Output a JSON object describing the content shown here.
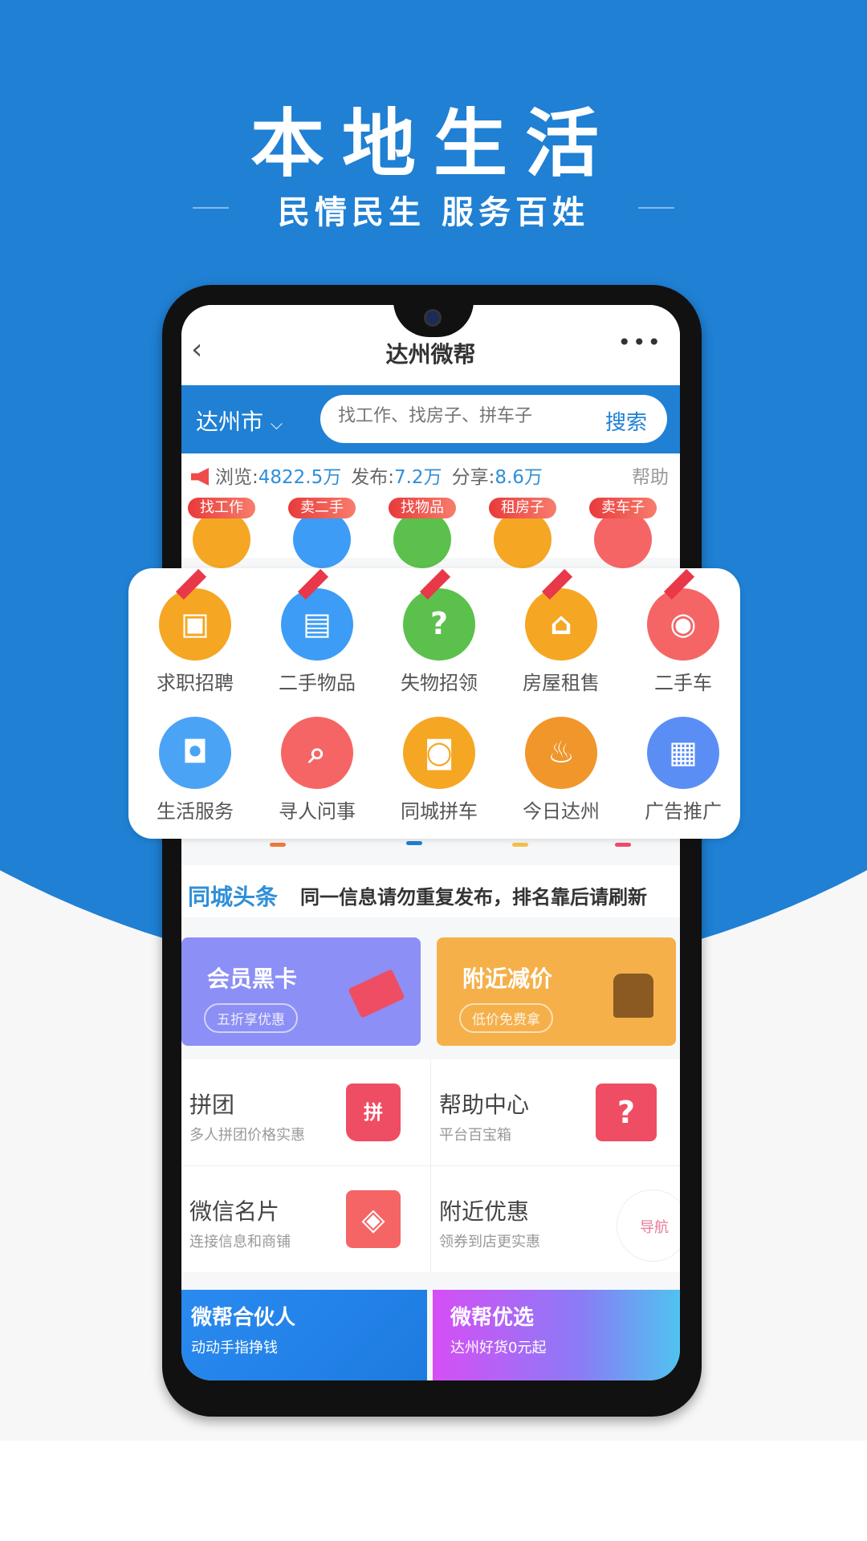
{
  "hero": {
    "title": "本地生活",
    "subtitle": "民情民生 服务百姓"
  },
  "app": {
    "title": "达州微帮",
    "back_icon": "‹",
    "more_icon": "•••",
    "city": "达州市",
    "city_chevron": "⌵",
    "search": {
      "placeholder": "找工作、找房子、拼车子",
      "button": "搜索"
    },
    "stats": {
      "views_label": "浏览:",
      "views": "4822.5万",
      "posts_label": "发布:",
      "posts": "7.2万",
      "shares_label": "分享:",
      "shares": "8.6万",
      "help": "帮助"
    },
    "badges": [
      {
        "tag": "找工作",
        "color": "#f5a623"
      },
      {
        "tag": "卖二手",
        "color": "#3d9cf5"
      },
      {
        "tag": "找物品",
        "color": "#5cc04c"
      },
      {
        "tag": "租房子",
        "color": "#f5a623"
      },
      {
        "tag": "卖车子",
        "color": "#f56565"
      }
    ],
    "categories": [
      {
        "label": "求职招聘",
        "icon": "briefcase-icon",
        "glyph": "▣",
        "color": "#f5a623",
        "ribbon": true
      },
      {
        "label": "二手物品",
        "icon": "bag-icon",
        "glyph": "▤",
        "color": "#3d9cf5",
        "ribbon": true
      },
      {
        "label": "失物招领",
        "icon": "lost-found-icon",
        "glyph": "?",
        "color": "#5cc04c",
        "ribbon": true
      },
      {
        "label": "房屋租售",
        "icon": "house-icon",
        "glyph": "⌂",
        "color": "#f5a623",
        "ribbon": true
      },
      {
        "label": "二手车",
        "icon": "car-icon",
        "glyph": "◉",
        "color": "#f56565",
        "ribbon": true
      },
      {
        "label": "生活服务",
        "icon": "service-icon",
        "glyph": "◘",
        "color": "#4ba3f5",
        "ribbon": false
      },
      {
        "label": "寻人问事",
        "icon": "search-person-icon",
        "glyph": "⌕",
        "color": "#f56565",
        "ribbon": false
      },
      {
        "label": "同城拼车",
        "icon": "taxi-icon",
        "glyph": "◙",
        "color": "#f5a623",
        "ribbon": false
      },
      {
        "label": "今日达州",
        "icon": "fire-icon",
        "glyph": "♨",
        "color": "#f0962a",
        "ribbon": false
      },
      {
        "label": "广告推广",
        "icon": "shop-icon",
        "glyph": "▦",
        "color": "#5b8ef5",
        "ribbon": false
      }
    ],
    "headline": {
      "label": "同城头条",
      "text": "同一信息请勿重复发布，排名靠后请刷新"
    },
    "promos": [
      {
        "title": "会员黑卡",
        "pill": "五折享优惠",
        "color": "#8c8ff5"
      },
      {
        "title": "附近减价",
        "pill": "低价免费拿",
        "color": "#f5b04a"
      }
    ],
    "grid": [
      {
        "title": "拼团",
        "sub": "多人拼团价格实惠",
        "glyph": "拼"
      },
      {
        "title": "帮助中心",
        "sub": "平台百宝箱",
        "glyph": "?"
      },
      {
        "title": "微信名片",
        "sub": "连接信息和商铺",
        "glyph": "◈"
      },
      {
        "title": "附近优惠",
        "sub": "领券到店更实惠",
        "glyph": ""
      }
    ],
    "nav_float": "导航",
    "banners": [
      {
        "title": "微帮合伙人",
        "sub": "动动手指挣钱"
      },
      {
        "title": "微帮优选",
        "sub": "达州好货0元起"
      }
    ]
  }
}
